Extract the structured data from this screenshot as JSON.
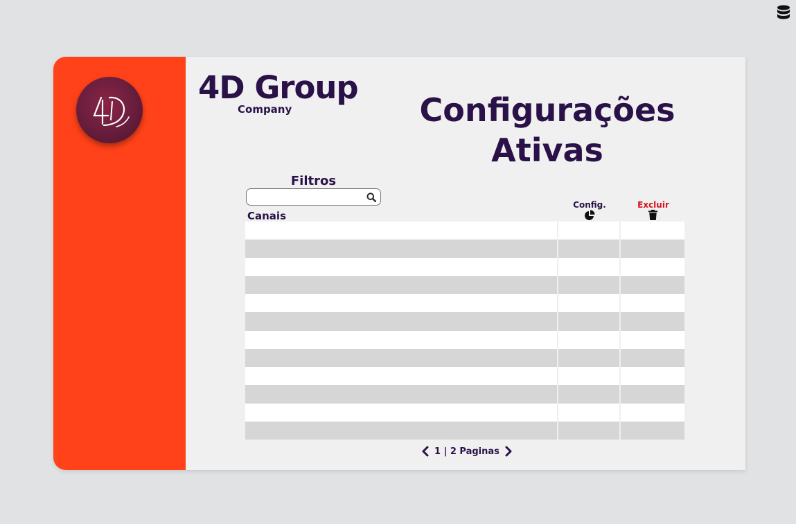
{
  "brand": {
    "title": "4D Group",
    "subtitle": "Company"
  },
  "page": {
    "title_line1": "Configurações",
    "title_line2": "Ativas"
  },
  "filters": {
    "label": "Filtros",
    "search_value": "",
    "search_placeholder": ""
  },
  "table": {
    "columns": {
      "channels": "Canais",
      "config": "Config.",
      "delete": "Excluir"
    },
    "rows": [
      {
        "canal": "",
        "config": "",
        "excluir": ""
      },
      {
        "canal": "",
        "config": "",
        "excluir": ""
      },
      {
        "canal": "",
        "config": "",
        "excluir": ""
      },
      {
        "canal": "",
        "config": "",
        "excluir": ""
      },
      {
        "canal": "",
        "config": "",
        "excluir": ""
      },
      {
        "canal": "",
        "config": "",
        "excluir": ""
      },
      {
        "canal": "",
        "config": "",
        "excluir": ""
      },
      {
        "canal": "",
        "config": "",
        "excluir": ""
      },
      {
        "canal": "",
        "config": "",
        "excluir": ""
      },
      {
        "canal": "",
        "config": "",
        "excluir": ""
      },
      {
        "canal": "",
        "config": "",
        "excluir": ""
      },
      {
        "canal": "",
        "config": "",
        "excluir": ""
      }
    ]
  },
  "pagination": {
    "text": "1 | 2 Paginas"
  },
  "icons": {
    "database": "database-icon",
    "search": "search-icon",
    "config": "pie-chart-icon",
    "delete": "trash-icon",
    "prev": "chevron-left-icon",
    "next": "chevron-right-icon"
  },
  "colors": {
    "sidebar": "#ff4219",
    "primary_text": "#2a1248",
    "danger": "#d4141e",
    "background": "#e1e2e4",
    "card": "#f0f0f0",
    "row_alt": "#d6d6d6"
  }
}
